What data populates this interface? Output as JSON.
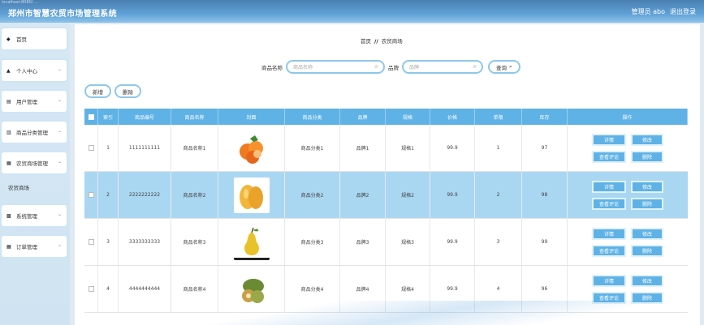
{
  "header": {
    "tiny_text": "localhost:8080/ ...",
    "title": "郑州市智慧农贸市场管理系统",
    "user": "管理员 abo",
    "logout": "退出登录"
  },
  "sidebar": {
    "items": [
      {
        "icon": "◆",
        "label": "首页",
        "chev": ""
      },
      {
        "icon": "▲",
        "label": "个人中心",
        "chev": "⌄"
      },
      {
        "icon": "▤",
        "label": "用户管理",
        "chev": "⌄"
      },
      {
        "icon": "▥",
        "label": "商品分类管理",
        "chev": "⌄"
      },
      {
        "icon": "▦",
        "label": "农贸商场管理",
        "chev": "⌄"
      },
      {
        "icon": "▩",
        "label": "系统管理",
        "chev": "⌄"
      },
      {
        "icon": "▦",
        "label": "订单管理",
        "chev": "⌄"
      }
    ],
    "sub_item": "农贸商场"
  },
  "breadcrumb": {
    "home": "首页",
    "sep": "//",
    "current": "农贸商场"
  },
  "search": {
    "label1": "商品名称",
    "placeholder1": "商品名称",
    "label2": "品牌",
    "placeholder2": "品牌",
    "button": "查询"
  },
  "toolbar": {
    "add": "新增",
    "delete": "删除"
  },
  "table": {
    "headers": [
      "索引",
      "商品编号",
      "商品名称",
      "封面",
      "商品分类",
      "品牌",
      "规格",
      "价格",
      "单限",
      "库存",
      "操作"
    ],
    "rows": [
      {
        "index": "1",
        "code": "1111111111",
        "name": "商品名称1",
        "category": "商品分类1",
        "brand": "品牌1",
        "spec": "规格1",
        "price": "99.9",
        "limit": "1",
        "stock": "97"
      },
      {
        "index": "2",
        "code": "2222222222",
        "name": "商品名称2",
        "category": "商品分类2",
        "brand": "品牌2",
        "spec": "规格2",
        "price": "99.9",
        "limit": "2",
        "stock": "98"
      },
      {
        "index": "3",
        "code": "3333333333",
        "name": "商品名称3",
        "category": "商品分类3",
        "brand": "品牌3",
        "spec": "规格3",
        "price": "99.9",
        "limit": "3",
        "stock": "99"
      },
      {
        "index": "4",
        "code": "4444444444",
        "name": "商品名称4",
        "category": "商品分类4",
        "brand": "品牌4",
        "spec": "规格4",
        "price": "99.9",
        "limit": "4",
        "stock": "96"
      }
    ],
    "ops": {
      "detail": "详情",
      "edit": "修改",
      "review": "查看评论",
      "remove": "删除"
    }
  },
  "colors": {
    "accent": "#5fb2e6",
    "highlight_row": "#a9d7f2",
    "header": "#4a7fb1"
  }
}
